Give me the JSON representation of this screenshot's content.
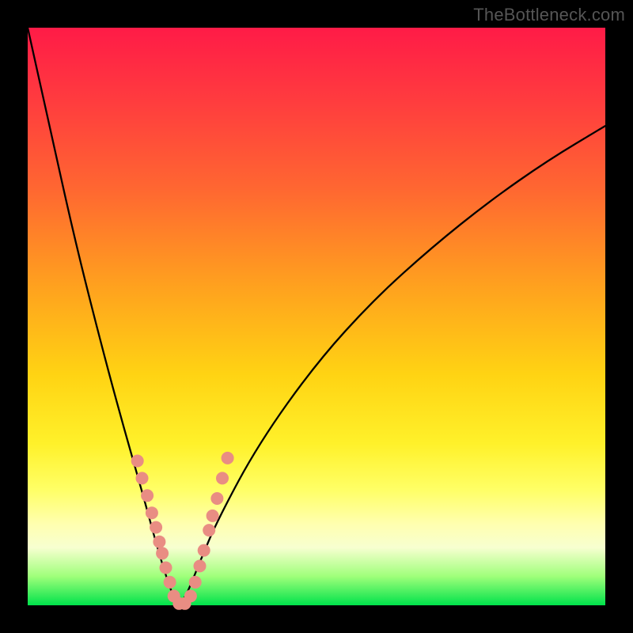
{
  "watermark": {
    "text": "TheBottleneck.com"
  },
  "chart_data": {
    "type": "line",
    "title": "",
    "xlabel": "",
    "ylabel": "",
    "xlim": [
      0,
      100
    ],
    "ylim": [
      0,
      100
    ],
    "grid": false,
    "legend": false,
    "series": [
      {
        "name": "bottleneck-curve",
        "note": "Estimated percentage bottleneck vs. horizontal position; V-shaped minimum near x≈26.",
        "x": [
          0,
          4,
          8,
          12,
          16,
          20,
          23,
          25,
          26,
          27,
          28,
          30,
          33,
          40,
          50,
          60,
          70,
          80,
          90,
          100
        ],
        "values": [
          100,
          82,
          64,
          48,
          33,
          19,
          8,
          2,
          0,
          1,
          3,
          8,
          15,
          28,
          42,
          53,
          62,
          70,
          77,
          83
        ]
      }
    ],
    "markers": {
      "note": "Salmon dot marker positions along the curve near the minimum (left and right arms).",
      "color": "#e98d83",
      "radius_px": 8,
      "points_xy_percent": [
        [
          19.0,
          25.0
        ],
        [
          19.8,
          22.0
        ],
        [
          20.7,
          19.0
        ],
        [
          21.5,
          16.0
        ],
        [
          22.2,
          13.5
        ],
        [
          22.8,
          11.0
        ],
        [
          23.3,
          9.0
        ],
        [
          23.9,
          6.5
        ],
        [
          24.6,
          4.0
        ],
        [
          25.3,
          1.6
        ],
        [
          26.2,
          0.3
        ],
        [
          27.2,
          0.3
        ],
        [
          28.2,
          1.6
        ],
        [
          29.0,
          4.0
        ],
        [
          29.8,
          6.8
        ],
        [
          30.5,
          9.5
        ],
        [
          31.4,
          13.0
        ],
        [
          32.0,
          15.5
        ],
        [
          32.8,
          18.5
        ],
        [
          33.7,
          22.0
        ],
        [
          34.6,
          25.5
        ]
      ]
    },
    "background_gradient": {
      "orientation": "vertical",
      "stops": [
        {
          "pos": 0.0,
          "color": "#ff1b47"
        },
        {
          "pos": 0.28,
          "color": "#ff6731"
        },
        {
          "pos": 0.6,
          "color": "#ffd313"
        },
        {
          "pos": 0.86,
          "color": "#ffffb0"
        },
        {
          "pos": 1.0,
          "color": "#00e24b"
        }
      ]
    }
  }
}
